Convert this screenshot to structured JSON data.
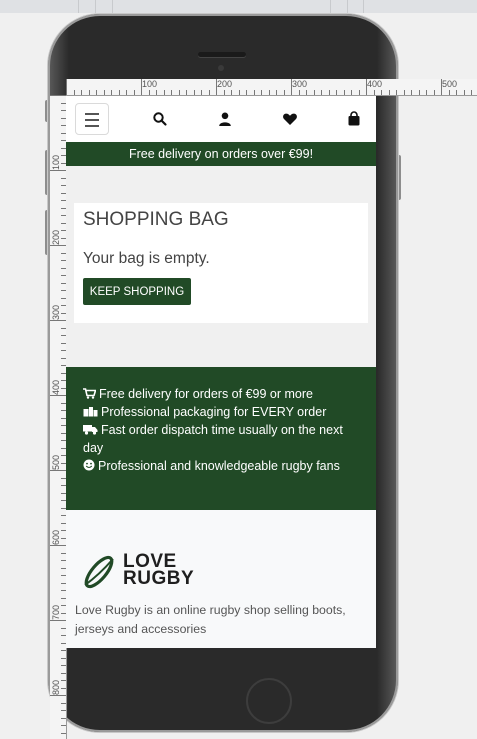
{
  "ruler": {
    "h_labels": [
      "100",
      "200",
      "300",
      "400",
      "500"
    ],
    "v_labels": [
      "100",
      "200",
      "300",
      "400",
      "500",
      "600",
      "700",
      "800"
    ]
  },
  "nav": {
    "menu_icon": "hamburger-icon",
    "icons": [
      "search-icon",
      "user-icon",
      "heart-icon",
      "shopping-bag-icon"
    ]
  },
  "banner": {
    "text": "Free delivery on orders over €99!"
  },
  "bag": {
    "title": "SHOPPING BAG",
    "empty_text": "Your bag is empty.",
    "keep_shopping_label": "KEEP SHOPPING"
  },
  "features": {
    "items": [
      {
        "icon": "cart-icon",
        "text": "Free delivery for orders of €99 or more"
      },
      {
        "icon": "box-icon",
        "text": "Professional packaging for EVERY order"
      },
      {
        "icon": "truck-icon",
        "text": "Fast order dispatch time usually on the next day"
      },
      {
        "icon": "smile-icon",
        "text": "Professional and knowledgeable rugby fans"
      }
    ]
  },
  "footer": {
    "logo_line1": "LOVE",
    "logo_line2": "RUGBY",
    "about": "Love Rugby is an online rugby shop selling boots, jerseys and accessories"
  },
  "colors": {
    "brand_green": "#214a26",
    "nav_bg": "#ffffff",
    "page_bg": "#f0f0f0"
  }
}
